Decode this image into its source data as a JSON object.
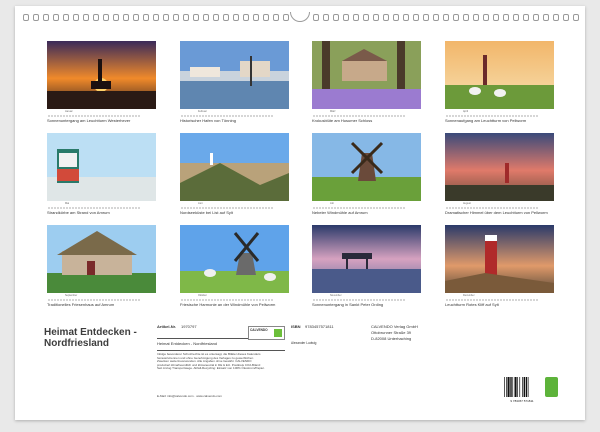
{
  "photos": [
    {
      "month": "Januar",
      "caption": "Sonnenuntergang am Leuchtturm Westerhever"
    },
    {
      "month": "Februar",
      "caption": "Historischer Hafen von Tönning"
    },
    {
      "month": "März",
      "caption": "Krokusblüte am Husumer Schloss"
    },
    {
      "month": "April",
      "caption": "Sonnenaufgang am Leuchtturm von Pellworm"
    },
    {
      "month": "Mai",
      "caption": "Strandkörbe am Strand von Amrum"
    },
    {
      "month": "Juni",
      "caption": "Nordseeküste bei List auf Sylt"
    },
    {
      "month": "Juli",
      "caption": "Nebeler Windmühle auf Amrum"
    },
    {
      "month": "August",
      "caption": "Dramatischer Himmel über dem Leuchtturm von Pellworm"
    },
    {
      "month": "September",
      "caption": "Traditionelles Friesenhaus auf Amrum"
    },
    {
      "month": "Oktober",
      "caption": "Friesische Harmonie an der Windmühle von Pellworm"
    },
    {
      "month": "November",
      "caption": "Sonnenuntergang in Sankt Peter Ording"
    },
    {
      "month": "Dezember",
      "caption": "Leuchtturm Rotes Kliff auf Sylt"
    }
  ],
  "product": {
    "title": "Heimat Entdecken - Nordfriesland",
    "article_label": "Artikel-Nr.",
    "article_no": "1970797",
    "subtitle": "Heimat Entdecken - Nordfriesland",
    "description": "Infolge besonderer Schutzrechte ist es untersagt, die Blätter dieses Kalenders herauszutrennen und ohne Genehmigung des Verlages zu gewerblichen Zwecken weiterzuverwenden. Alle Angaben ohne Gewähr. CALVENDO produziert klimafreundlich und klimaneutral in DE & EU. Postkreis CO2-Bilanz: Seit Anzug Transportwege. Abfall-Recycling: Einsatz von 100% Ökostrom/Papier.",
    "website": "E-Mail: info@calvendo.com · www.calvendo.com",
    "logo_text": "CALVENDO",
    "isbn_label": "ISBN",
    "isbn": "9783457571811",
    "author": "Alexander Ludwig",
    "publisher_name": "CALVENDO Verlag GmbH",
    "publisher_street": "Ottobrunner Straße 39",
    "publisher_city": "D-82008 Unterhaching",
    "barcode_number": "9 783457 571811"
  },
  "colors": {
    "accent": "#5db33a",
    "frame": "#e9e9e9"
  }
}
